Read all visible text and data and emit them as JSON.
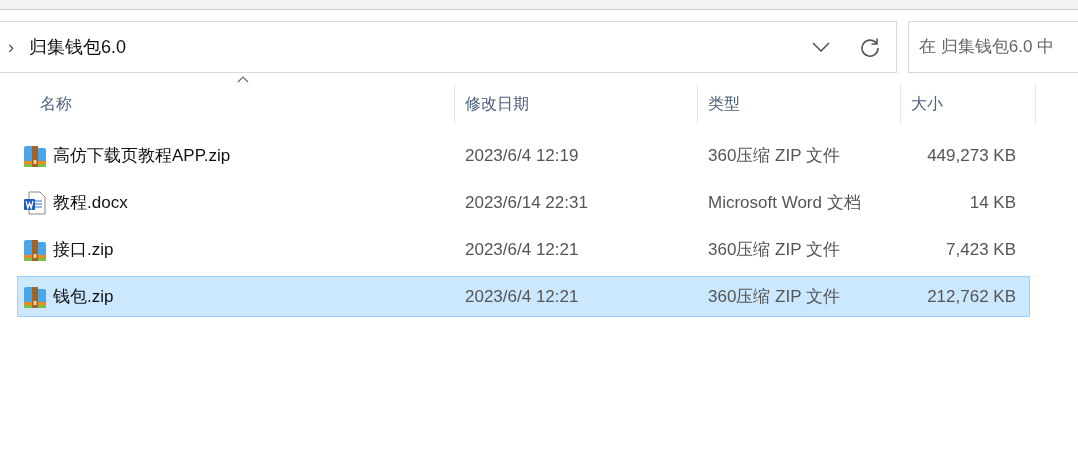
{
  "address_bar": {
    "chevron": "›",
    "path": "归集钱包6.0"
  },
  "search": {
    "placeholder": "在 归集钱包6.0 中"
  },
  "columns": [
    {
      "label": "名称",
      "sorted": true
    },
    {
      "label": "修改日期",
      "sorted": false
    },
    {
      "label": "类型",
      "sorted": false
    },
    {
      "label": "大小",
      "sorted": false
    }
  ],
  "files": [
    {
      "kind": "zip",
      "name": "高仿下载页教程APP.zip",
      "modified": "2023/6/4 12:19",
      "type": "360压缩 ZIP 文件",
      "size": "449,273 KB",
      "selected": false
    },
    {
      "kind": "word",
      "name": "教程.docx",
      "modified": "2023/6/14 22:31",
      "type": "Microsoft Word 文档",
      "size": "14 KB",
      "selected": false
    },
    {
      "kind": "zip",
      "name": "接口.zip",
      "modified": "2023/6/4 12:21",
      "type": "360压缩 ZIP 文件",
      "size": "7,423 KB",
      "selected": false
    },
    {
      "kind": "zip",
      "name": "钱包.zip",
      "modified": "2023/6/4 12:21",
      "type": "360压缩 ZIP 文件",
      "size": "212,762 KB",
      "selected": true
    }
  ]
}
